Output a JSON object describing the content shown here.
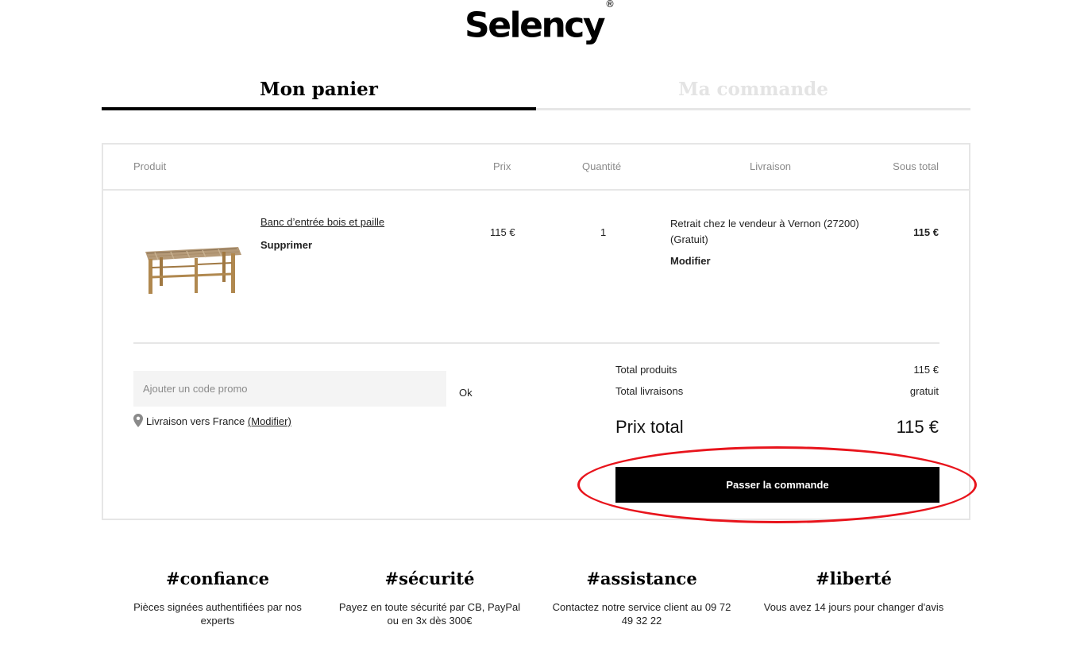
{
  "brand": {
    "name": "Selency",
    "mark": "®"
  },
  "tabs": {
    "cart": "Mon panier",
    "order": "Ma commande"
  },
  "table": {
    "headers": {
      "product": "Produit",
      "price": "Prix",
      "quantity": "Quantité",
      "delivery": "Livraison",
      "subtotal": "Sous total"
    },
    "item": {
      "name": "Banc d’entrée bois et paille",
      "remove": "Supprimer",
      "price": "115 €",
      "quantity": "1",
      "delivery": "Retrait chez le vendeur à Vernon (27200) (Gratuit)",
      "delivery_modify": "Modifier",
      "subtotal": "115 €"
    }
  },
  "promo": {
    "placeholder": "Ajouter un code promo",
    "ok": "Ok"
  },
  "delivery_country": {
    "text": "Livraison vers France",
    "link": "(Modifier)"
  },
  "totals": {
    "products_label": "Total produits",
    "products_value": "115 €",
    "shipping_label": "Total livraisons",
    "shipping_value": "gratuit",
    "total_label": "Prix total",
    "total_value": "115 €"
  },
  "checkout": {
    "label": "Passer la commande"
  },
  "features": [
    {
      "title": "#confiance",
      "desc": "Pièces signées authentifiées par nos experts"
    },
    {
      "title": "#sécurité",
      "desc": "Payez en toute sécurité par CB, PayPal ou en 3x dès 300€"
    },
    {
      "title": "#assistance",
      "desc": "Contactez notre service client au 09 72 49 32 22"
    },
    {
      "title": "#liberté",
      "desc": "Vous avez 14 jours pour changer d'avis"
    }
  ],
  "colors": {
    "accent": "#000000",
    "annotation": "#e8141c",
    "muted": "#8a8a8a",
    "border": "#e6e6e6"
  }
}
